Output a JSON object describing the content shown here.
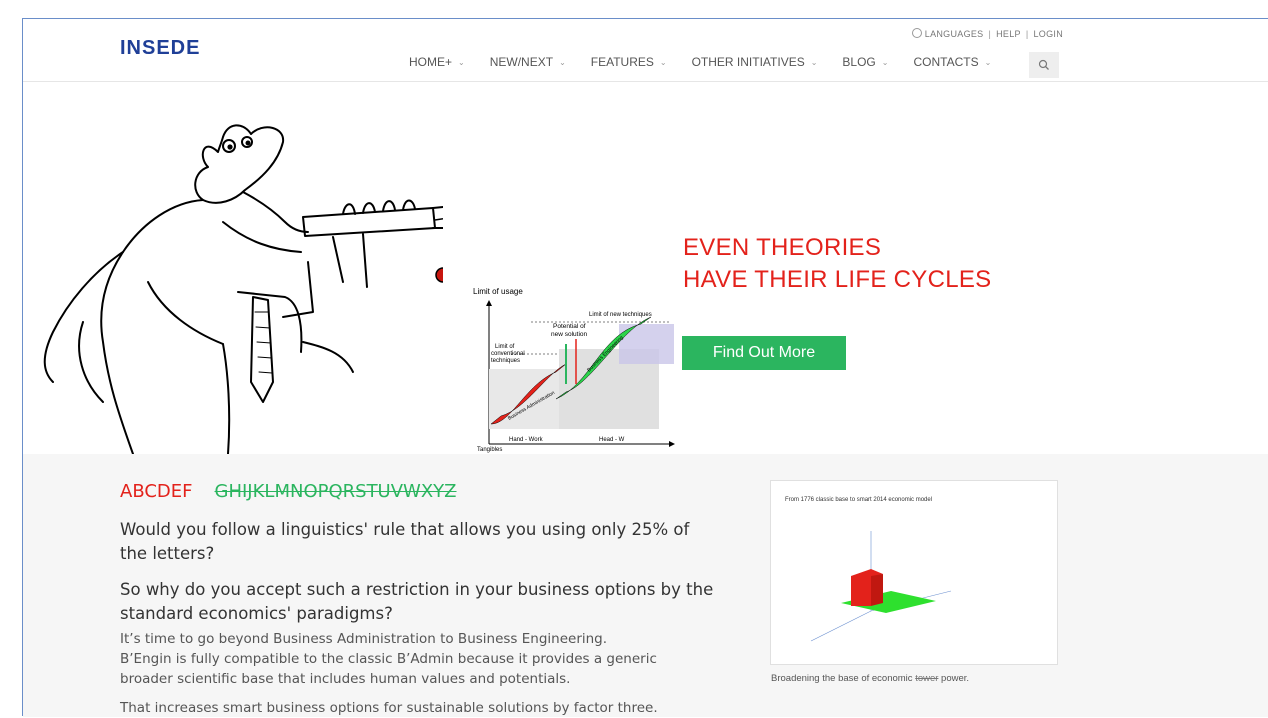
{
  "header": {
    "logo": "INSEDE",
    "utility": {
      "languages": "LANGUAGES",
      "help": "HELP",
      "login": "LOGIN"
    },
    "nav": [
      {
        "label": "HOME+"
      },
      {
        "label": "NEW/NEXT"
      },
      {
        "label": "FEATURES"
      },
      {
        "label": "OTHER INITIATIVES"
      },
      {
        "label": "BLOG"
      },
      {
        "label": "CONTACTS"
      }
    ],
    "search_icon": "search-icon"
  },
  "hero": {
    "title_line1": "EVEN THEORIES",
    "title_line2": "HAVE THEIR LIFE CYCLES",
    "cta": "Find Out More",
    "diagram": {
      "limit_usage": "Limit of usage",
      "potential": "Potential of",
      "new_solution": "new solution",
      "limit_new": "Limit of new techniques",
      "limit_conv1": "Limit of",
      "limit_conv2": "conventional",
      "limit_conv3": "techniques",
      "hand_work": "Hand - Work",
      "head_work": "Head - W",
      "tangibles": "Tangibles",
      "business_admin": "Business Administration",
      "business_eng": "Business Engineering"
    }
  },
  "content": {
    "abc_red": "ABCDEF",
    "abc_green": "GHIJKLMNOPQRSTUVWXYZ",
    "q1": "Would you follow a linguistics' rule that allows you using only 25% of the letters?",
    "q2": "So why do you accept such a restriction in your business options by the standard economics' paradigms?",
    "p1_line1": "It’s time to go beyond Business Administration to Business Engineering.",
    "p1_line2": "B’Engin is fully compatible to the classic B’Admin because it provides a generic",
    "p1_line3": "broader scientific base that includes human values and potentials.",
    "p2": "That increases smart business options for sustainable solutions by factor three.",
    "figure_title": "From 1776 classic base to smart 2014 economic model",
    "caption_start": "Broadening the base of economic ",
    "caption_strike": "tower",
    "caption_end": " power."
  },
  "colors": {
    "accent_red": "#e3221b",
    "accent_green": "#2bb55f",
    "logo_blue": "#1f3f97"
  }
}
